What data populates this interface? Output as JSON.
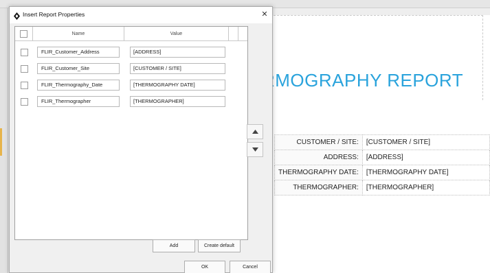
{
  "dialog": {
    "title": "Insert Report Properties",
    "close_glyph": "✕",
    "columns": {
      "name": "Name",
      "value": "Value"
    },
    "rows": [
      {
        "name": "FLIR_Customer_Address",
        "value": "[ADDRESS]",
        "checked": false
      },
      {
        "name": "FLIR_Customer_Site",
        "value": "[CUSTOMER / SITE]",
        "checked": false
      },
      {
        "name": "FLIR_Thermography_Date",
        "value": "[THERMOGRAPHY DATE]",
        "checked": false
      },
      {
        "name": "FLIR_Thermographer",
        "value": "[THERMOGRAPHER]",
        "checked": false
      }
    ],
    "buttons": {
      "add": "Add",
      "create_default": "Create default",
      "ok": "OK",
      "cancel": "Cancel",
      "move_up_icon": "triangle-up-icon",
      "move_down_icon": "triangle-down-icon"
    }
  },
  "document": {
    "title_visible": "RMOGRAPHY REPORT",
    "title_color": "#2aa3dc",
    "table": [
      {
        "label": "CUSTOMER / SITE:",
        "value": "[CUSTOMER / SITE]"
      },
      {
        "label": "ADDRESS:",
        "value": "[ADDRESS]"
      },
      {
        "label": "THERMOGRAPHY DATE:",
        "value": "[THERMOGRAPHY DATE]"
      },
      {
        "label": "THERMOGRAPHER:",
        "value": "[THERMOGRAPHER]"
      }
    ]
  }
}
